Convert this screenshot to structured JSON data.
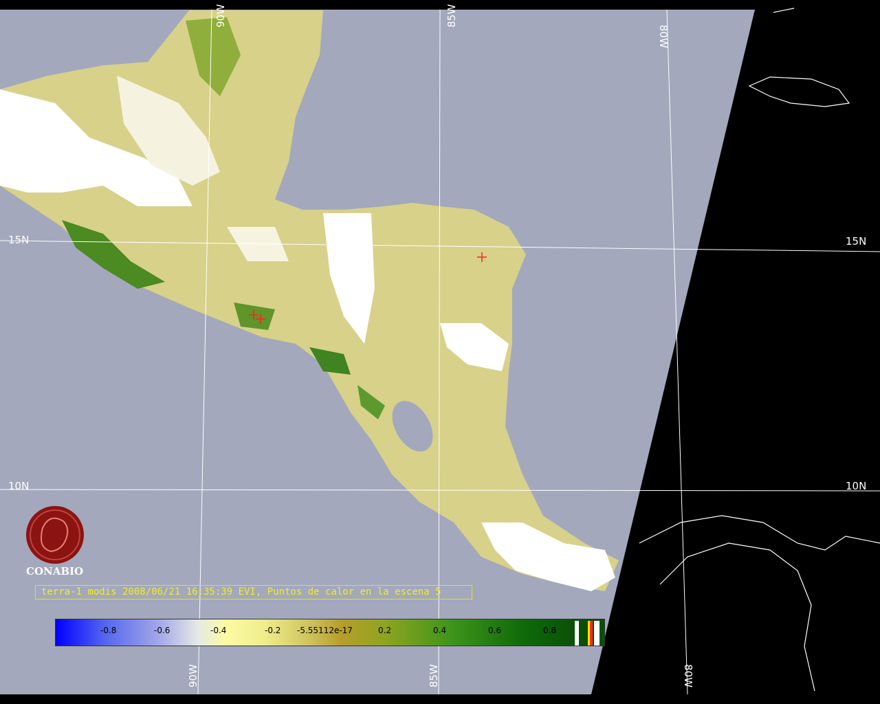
{
  "map": {
    "grid_labels": {
      "lon_top_85": "85W",
      "lon_top_80": "80W",
      "lon_top_90": "90W",
      "lon_bottom_90": "90W",
      "lon_bottom_85": "85W",
      "lon_bottom_80": "80W",
      "lat_left_15": "15N",
      "lat_right_15": "15N",
      "lat_left_10": "10N",
      "lat_right_10": "10N"
    },
    "colors": {
      "ocean": "#a3a8bc",
      "night": "#000000",
      "cloud": "#ffffff",
      "vegetation_light": "#d9d27e",
      "vegetation_dark": "#2f7d19",
      "grid": "#ffffff",
      "hotspot": "#ff2020"
    }
  },
  "logo": {
    "name": "CONABIO"
  },
  "caption": {
    "text": "terra-1 modis 2008/06/21 16:35:39 EVI, Puntos de calor en la escena 5"
  },
  "colorbar": {
    "labels": [
      "-0.8",
      "-0.6",
      "-0.4",
      "-0.2",
      "-5.55112e-17",
      "0.2",
      "0.4",
      "0.6",
      "0.8"
    ]
  }
}
